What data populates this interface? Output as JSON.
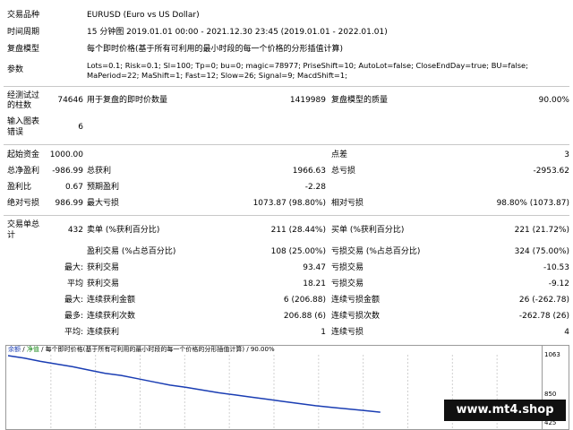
{
  "header": {
    "symbol_label": "交易品种",
    "symbol_value": "EURUSD (Euro vs US Dollar)",
    "period_label": "时间周期",
    "period_value": "15 分钟图 2019.01.01 00:00 - 2021.12.30 23:45 (2019.01.01 - 2022.01.01)",
    "model_label": "复盘模型",
    "model_value": "每个即时价格(基于所有可利用的最小时段的每一个价格的分形插值计算)",
    "params_label": "参数",
    "params_line1": "Lots=0.1; Risk=0.1; Sl=100; Tp=0; bu=0; magic=78977; PriseShift=10; AutoLot=false; CloseEndDay=true; BU=false;",
    "params_line2": "MaPeriod=22; MaShift=1; Fast=12; Slow=26; Signal=9; MacdShift=1;"
  },
  "bars": {
    "label_line1": "经测试过",
    "label_line2": "的柱数",
    "value": "74646",
    "ticks_label": "用于复盘的即时价数量",
    "ticks_value": "1419989",
    "quality_label": "复盘模型的质量",
    "quality_value": "90.00%"
  },
  "errors": {
    "label_line1": "输入图表",
    "label_line2": "错误",
    "value": "6"
  },
  "stats": {
    "deposit_label": "起始资金",
    "deposit_value": "1000.00",
    "spread_label": "点差",
    "spread_value": "3",
    "net_label": "总净盈利",
    "net_value": "-986.99",
    "gross_profit_label": "总获利",
    "gross_profit_value": "1966.63",
    "gross_loss_label": "总亏损",
    "gross_loss_value": "-2953.62",
    "pf_label": "盈利比",
    "pf_value": "0.67",
    "expected_label": "预期盈利",
    "expected_value": "-2.28",
    "abs_dd_label": "绝对亏损",
    "abs_dd_value": "986.99",
    "max_dd_label": "最大亏损",
    "max_dd_value": "1073.87 (98.80%)",
    "rel_dd_label": "相对亏损",
    "rel_dd_value": "98.80% (1073.87)"
  },
  "trades": {
    "total_label_line1": "交易单总",
    "total_label_line2": "计",
    "total_value": "432",
    "short_label": "卖单 (%获利百分比)",
    "short_value": "211 (28.44%)",
    "long_label": "买单 (%获利百分比)",
    "long_value": "221 (21.72%)",
    "profit_trades_label": "盈利交易 (%占总百分比)",
    "profit_trades_value": "108 (25.00%)",
    "loss_trades_label": "亏损交易 (%占总百分比)",
    "loss_trades_value": "324 (75.00%)",
    "largest_prefix": "最大:",
    "largest_profit_label": "获利交易",
    "largest_profit_value": "93.47",
    "largest_loss_label": "亏损交易",
    "largest_loss_value": "-10.53",
    "average_prefix": "平均",
    "average_profit_label": "获利交易",
    "average_profit_value": "18.21",
    "average_loss_label": "亏损交易",
    "average_loss_value": "-9.12",
    "max_cons_prefix": "最大:",
    "max_cons_wins_label": "连续获利金额",
    "max_cons_wins_value": "6 (206.88)",
    "max_cons_losses_label": "连续亏损金额",
    "max_cons_losses_value": "26 (-262.78)",
    "maximal_prefix": "最多:",
    "maximal_profit_label": "连续获利次数",
    "maximal_profit_value": "206.88 (6)",
    "maximal_loss_label": "连续亏损次数",
    "maximal_loss_value": "-262.78 (26)",
    "avg_cons_prefix": "平均:",
    "avg_cons_wins_label": "连续获利",
    "avg_cons_wins_value": "1",
    "avg_cons_losses_label": "连续亏损",
    "avg_cons_losses_value": "4"
  },
  "chart": {
    "legend_balance": "余额",
    "legend_sep1": "/",
    "legend_equity": "净值",
    "legend_rest": "/ 每个即时价格(基于所有可利用的最小时段的每一个价格的分形插值计算) / 90.00%",
    "ticks": [
      "1063",
      "850",
      "425"
    ],
    "color_balance": "#1a3db3",
    "color_equity": "#1e8a1e"
  },
  "chart_data": {
    "type": "line",
    "title": "",
    "series": [
      {
        "name": "余额",
        "values": [
          1063,
          1040,
          1010,
          985,
          960,
          930,
          900,
          880,
          850,
          820,
          790,
          770,
          745,
          720,
          700,
          680,
          660,
          640,
          620,
          600,
          585,
          570,
          555,
          540
        ]
      }
    ],
    "ylabel": "",
    "xlabel": ""
  },
  "watermark": "www.mt4.shop"
}
